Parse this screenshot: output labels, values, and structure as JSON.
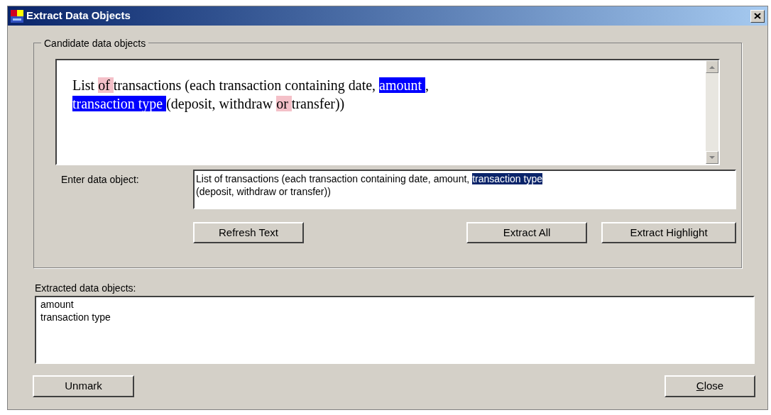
{
  "window": {
    "title": "Extract Data Objects"
  },
  "candidate_group": {
    "title": "Candidate data objects",
    "lines": [
      [
        {
          "text": "List ",
          "marked": false,
          "stop_word": false
        },
        {
          "text": "of ",
          "marked": false,
          "stop_word": true
        },
        {
          "text": "transactions (each transaction containing date, ",
          "marked": false,
          "stop_word": false
        },
        {
          "text": "amount ",
          "marked": true,
          "stop_word": false
        },
        {
          "text": ",",
          "marked": false,
          "stop_word": false
        }
      ],
      [
        {
          "text": "transaction type ",
          "marked": true,
          "stop_word": false
        },
        {
          "text": "(deposit, withdraw ",
          "marked": false,
          "stop_word": false
        },
        {
          "text": "or ",
          "marked": false,
          "stop_word": true
        },
        {
          "text": "transfer))",
          "marked": false,
          "stop_word": false
        }
      ]
    ]
  },
  "entry": {
    "label": "Enter data object:",
    "lines": [
      [
        {
          "text": "List of transactions (each transaction containing date, amount, ",
          "selected": false
        },
        {
          "text": "transaction type",
          "selected": true
        }
      ],
      [
        {
          "text": "(deposit, withdraw or transfer))",
          "selected": false
        }
      ]
    ]
  },
  "action_buttons": [
    "Refresh Text",
    "Extract All",
    "Extract Highlight"
  ],
  "extracted": {
    "label": "Extracted data objects:",
    "items": [
      "amount",
      "transaction type"
    ]
  },
  "bottom_buttons": [
    {
      "label": "Unmark",
      "underline_first": false
    },
    {
      "label": "Close",
      "underline_first": true
    }
  ]
}
